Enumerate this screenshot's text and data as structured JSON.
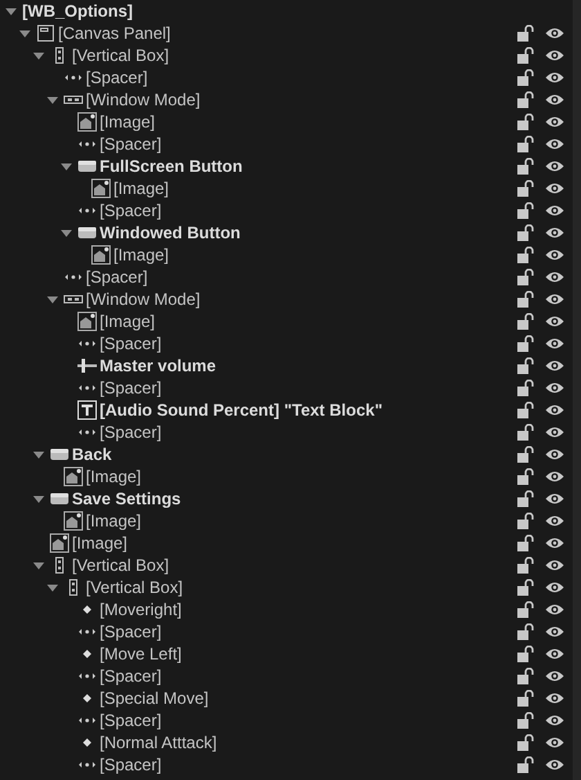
{
  "hierarchy": [
    {
      "kind": "root",
      "label": "[WB_Options]",
      "bold": true,
      "expanded": true,
      "children": [
        {
          "kind": "canvas",
          "label": "[Canvas Panel]",
          "bold": false,
          "expanded": true,
          "children": [
            {
              "kind": "vbox",
              "label": "[Vertical Box]",
              "bold": false,
              "expanded": true,
              "children": [
                {
                  "kind": "spacer",
                  "label": "[Spacer]",
                  "bold": false
                },
                {
                  "kind": "hbox",
                  "label": "[Window Mode]",
                  "bold": false,
                  "expanded": true,
                  "children": [
                    {
                      "kind": "image",
                      "label": "[Image]",
                      "bold": false
                    },
                    {
                      "kind": "spacer",
                      "label": "[Spacer]",
                      "bold": false
                    },
                    {
                      "kind": "button",
                      "label": "FullScreen Button",
                      "bold": true,
                      "expanded": true,
                      "children": [
                        {
                          "kind": "image",
                          "label": "[Image]",
                          "bold": false
                        }
                      ]
                    },
                    {
                      "kind": "spacer",
                      "label": "[Spacer]",
                      "bold": false
                    },
                    {
                      "kind": "button",
                      "label": "Windowed Button",
                      "bold": true,
                      "expanded": true,
                      "children": [
                        {
                          "kind": "image",
                          "label": "[Image]",
                          "bold": false
                        }
                      ]
                    }
                  ]
                },
                {
                  "kind": "spacer",
                  "label": "[Spacer]",
                  "bold": false
                },
                {
                  "kind": "hbox",
                  "label": "[Window Mode]",
                  "bold": false,
                  "expanded": true,
                  "children": [
                    {
                      "kind": "image",
                      "label": "[Image]",
                      "bold": false
                    },
                    {
                      "kind": "spacer",
                      "label": "[Spacer]",
                      "bold": false
                    },
                    {
                      "kind": "slider",
                      "label": "Master volume",
                      "bold": true
                    },
                    {
                      "kind": "spacer",
                      "label": "[Spacer]",
                      "bold": false
                    },
                    {
                      "kind": "text",
                      "label": "[Audio Sound Percent] \"Text Block\"",
                      "bold": true
                    },
                    {
                      "kind": "spacer",
                      "label": "[Spacer]",
                      "bold": false
                    }
                  ]
                }
              ]
            },
            {
              "kind": "button",
              "label": "Back",
              "bold": true,
              "expanded": true,
              "children": [
                {
                  "kind": "image",
                  "label": "[Image]",
                  "bold": false
                }
              ]
            },
            {
              "kind": "button",
              "label": "Save Settings",
              "bold": true,
              "expanded": true,
              "children": [
                {
                  "kind": "image",
                  "label": "[Image]",
                  "bold": false
                }
              ]
            },
            {
              "kind": "image",
              "label": "[Image]",
              "bold": false
            },
            {
              "kind": "vbox",
              "label": "[Vertical Box]",
              "bold": false,
              "expanded": true,
              "children": [
                {
                  "kind": "vbox",
                  "label": "[Vertical Box]",
                  "bold": false,
                  "expanded": true,
                  "children": [
                    {
                      "kind": "widget",
                      "label": "[Moveright]",
                      "bold": false
                    },
                    {
                      "kind": "spacer",
                      "label": "[Spacer]",
                      "bold": false
                    },
                    {
                      "kind": "widget",
                      "label": "[Move Left]",
                      "bold": false
                    },
                    {
                      "kind": "spacer",
                      "label": "[Spacer]",
                      "bold": false
                    },
                    {
                      "kind": "widget",
                      "label": "[Special Move]",
                      "bold": false
                    },
                    {
                      "kind": "spacer",
                      "label": "[Spacer]",
                      "bold": false
                    },
                    {
                      "kind": "widget",
                      "label": "[Normal Atttack]",
                      "bold": false
                    },
                    {
                      "kind": "spacer",
                      "label": "[Spacer]",
                      "bold": false
                    }
                  ]
                }
              ]
            }
          ]
        }
      ]
    }
  ]
}
